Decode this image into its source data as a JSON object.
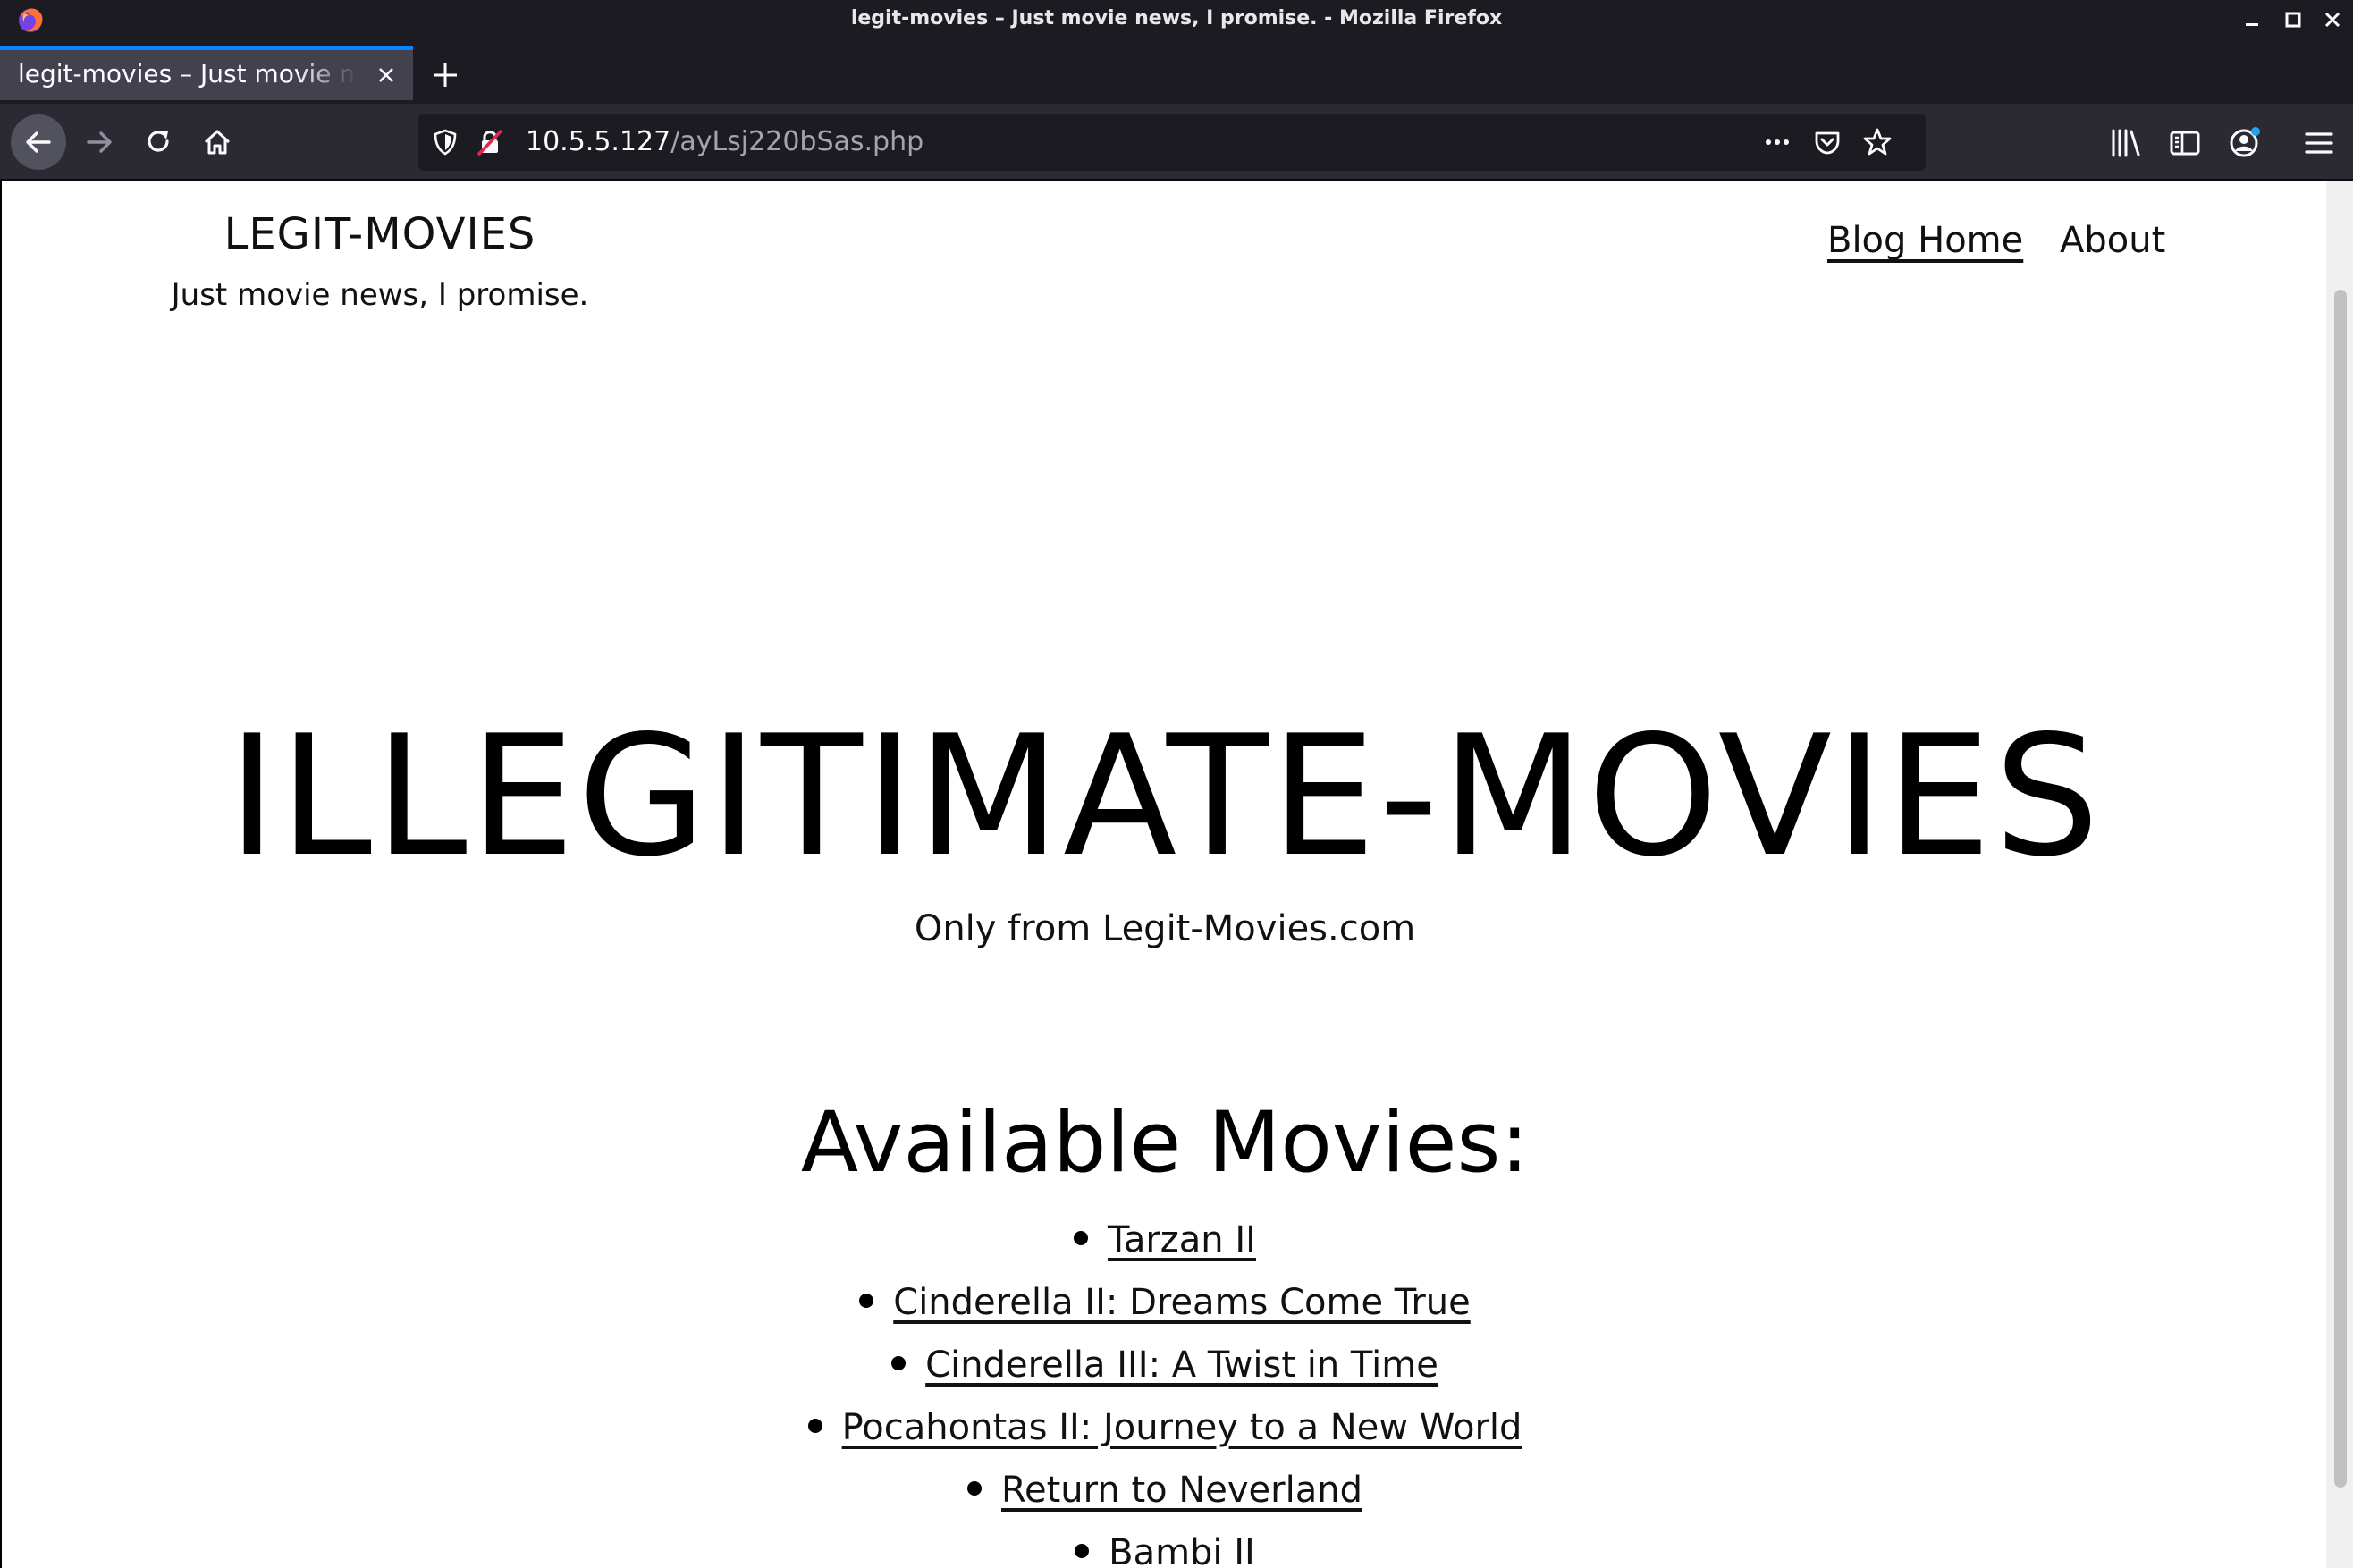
{
  "window": {
    "title": "legit-movies – Just movie news, I promise. - Mozilla Firefox"
  },
  "tabs": [
    {
      "label": "legit-movies – Just movie news, I promise.",
      "active": true
    }
  ],
  "urlbar": {
    "host": "10.5.5.127",
    "path": "/ayLsj220bSas.php"
  },
  "icons": {
    "nav": [
      "back-icon",
      "forward-icon",
      "reload-icon",
      "home-icon"
    ],
    "urlbar": [
      "tracking-shield-icon",
      "insecure-connection-icon",
      "page-actions-icon",
      "pocket-icon",
      "bookmark-star-icon"
    ],
    "toolbar": [
      "library-icon",
      "sidebar-icon",
      "account-icon",
      "menu-icon"
    ]
  },
  "colors": {
    "chrome_bg": "#1c1b22",
    "toolbar_bg": "#2b2a33",
    "active_tab": "#42414d",
    "tab_accent": "#0a84ff"
  },
  "site": {
    "title": "LEGIT-MOVIES",
    "tagline": "Just movie news, I promise.",
    "nav": [
      "Blog Home",
      "About"
    ]
  },
  "main": {
    "hero_title": "ILLEGITIMATE-MOVIES",
    "hero_subtitle": "Only from Legit-Movies.com",
    "list_heading": "Available Movies:",
    "movies": [
      "Tarzan II",
      "Cinderella II: Dreams Come True",
      "Cinderella III: A Twist in Time",
      "Pocahontas II: Journey to a New World",
      "Return to Neverland",
      "Bambi II"
    ]
  }
}
